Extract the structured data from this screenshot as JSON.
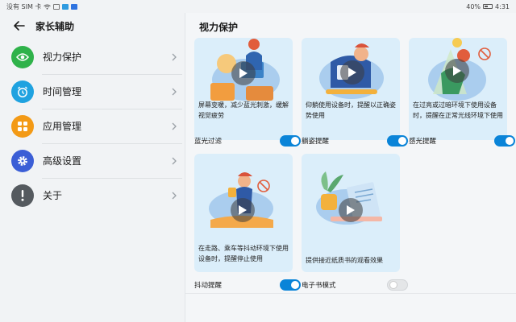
{
  "status_bar": {
    "left_text": "没有 SIM 卡",
    "battery": "40%",
    "time": "4:31"
  },
  "left": {
    "title": "家长辅助",
    "items": [
      {
        "label": "视力保护",
        "icon": "eye-icon",
        "color": "#2fb24a"
      },
      {
        "label": "时间管理",
        "icon": "alarm-clock-icon",
        "color": "#1fa2e0"
      },
      {
        "label": "应用管理",
        "icon": "apps-grid-icon",
        "color": "#f39a16"
      },
      {
        "label": "高级设置",
        "icon": "gear-icon",
        "color": "#3b5ed6"
      },
      {
        "label": "关于",
        "icon": "exclamation-icon",
        "color": "#555a5f"
      }
    ]
  },
  "right": {
    "title": "视力保护",
    "cards": [
      {
        "description": "屏幕变暖，减少蓝光刺激，缓解视觉疲劳",
        "toggle_label": "蓝光过滤",
        "toggle_on": true
      },
      {
        "description": "仰躺使用设备时，提醒以正确姿势使用",
        "toggle_label": "躺姿提醒",
        "toggle_on": true
      },
      {
        "description": "在过亮或过暗环境下使用设备时，提醒在正常光线环境下使用",
        "toggle_label": "感光提醒",
        "toggle_on": true
      },
      {
        "description": "在走路、乘车等抖动环境下使用设备时，提醒停止使用",
        "toggle_label": "抖动提醒",
        "toggle_on": true
      },
      {
        "description": "提供接近纸质书的观看效果",
        "toggle_label": "电子书模式",
        "toggle_on": false
      }
    ]
  },
  "colors": {
    "accent": "#0a84d8",
    "card_bg": "#dbeefa"
  }
}
